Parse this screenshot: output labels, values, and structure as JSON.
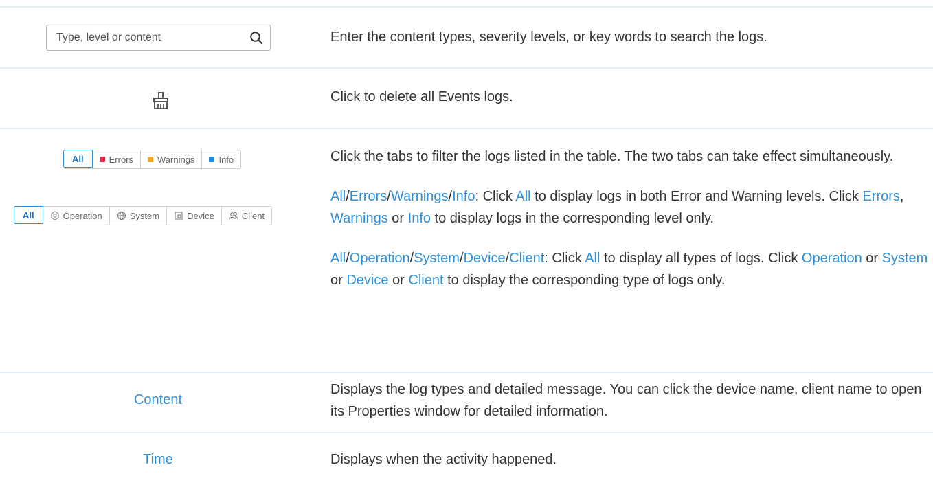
{
  "search": {
    "placeholder": "Type, level or content"
  },
  "level_tabs": [
    {
      "label": "All",
      "active": true
    },
    {
      "label": "Errors",
      "color": "#e8254a"
    },
    {
      "label": "Warnings",
      "color": "#f7a823"
    },
    {
      "label": "Info",
      "color": "#1e88e5"
    }
  ],
  "type_tabs": [
    {
      "label": "All",
      "active": true
    },
    {
      "label": "Operation",
      "icon": "gear-icon"
    },
    {
      "label": "System",
      "icon": "globe-icon"
    },
    {
      "label": "Device",
      "icon": "device-icon"
    },
    {
      "label": "Client",
      "icon": "users-icon"
    }
  ],
  "rows": {
    "search_desc": "Enter the content types, severity levels, or key words to search the logs.",
    "clear_desc": "Click to delete all Events logs.",
    "tabs_intro": "Click the tabs to filter the logs listed in the table. The two tabs can take effect simultaneously.",
    "level": {
      "t_all": "All",
      "s1": "/",
      "t_errors": "Errors",
      "s2": "/",
      "t_warnings": "Warnings",
      "s3": "/",
      "t_info": "Info",
      "p1": ": Click ",
      "all": "All",
      "p2": " to display logs in both Error and Warning levels. Click ",
      "errors": "Errors",
      "p3": ", ",
      "warnings": "Warnings",
      "p4": " or ",
      "info": "Info",
      "p5": " to display logs in the corresponding level only."
    },
    "type": {
      "t_all": "All",
      "s1": "/",
      "t_operation": "Operation",
      "s2": "/",
      "t_system": "System",
      "s3": "/",
      "t_device": "Device",
      "s4": "/",
      "t_client": "Client",
      "p1": ": Click ",
      "all": "All",
      "p2": " to display all types of logs. Click ",
      "operation": "Operation",
      "p3": " or ",
      "system": "System",
      "p4": " or ",
      "device": "Device",
      "p5": " or ",
      "client": "Client",
      "p6": " to display the corresponding type of logs only."
    },
    "content_label": "Content",
    "content_desc": "Displays the log types and detailed message. You can click the device name, client name to open its Properties window for detailed information.",
    "time_label": "Time",
    "time_desc": "Displays when the activity happened."
  },
  "colors": {
    "accent": "#2e8fd6",
    "separator": "#e3ecf4",
    "text": "#333333"
  }
}
